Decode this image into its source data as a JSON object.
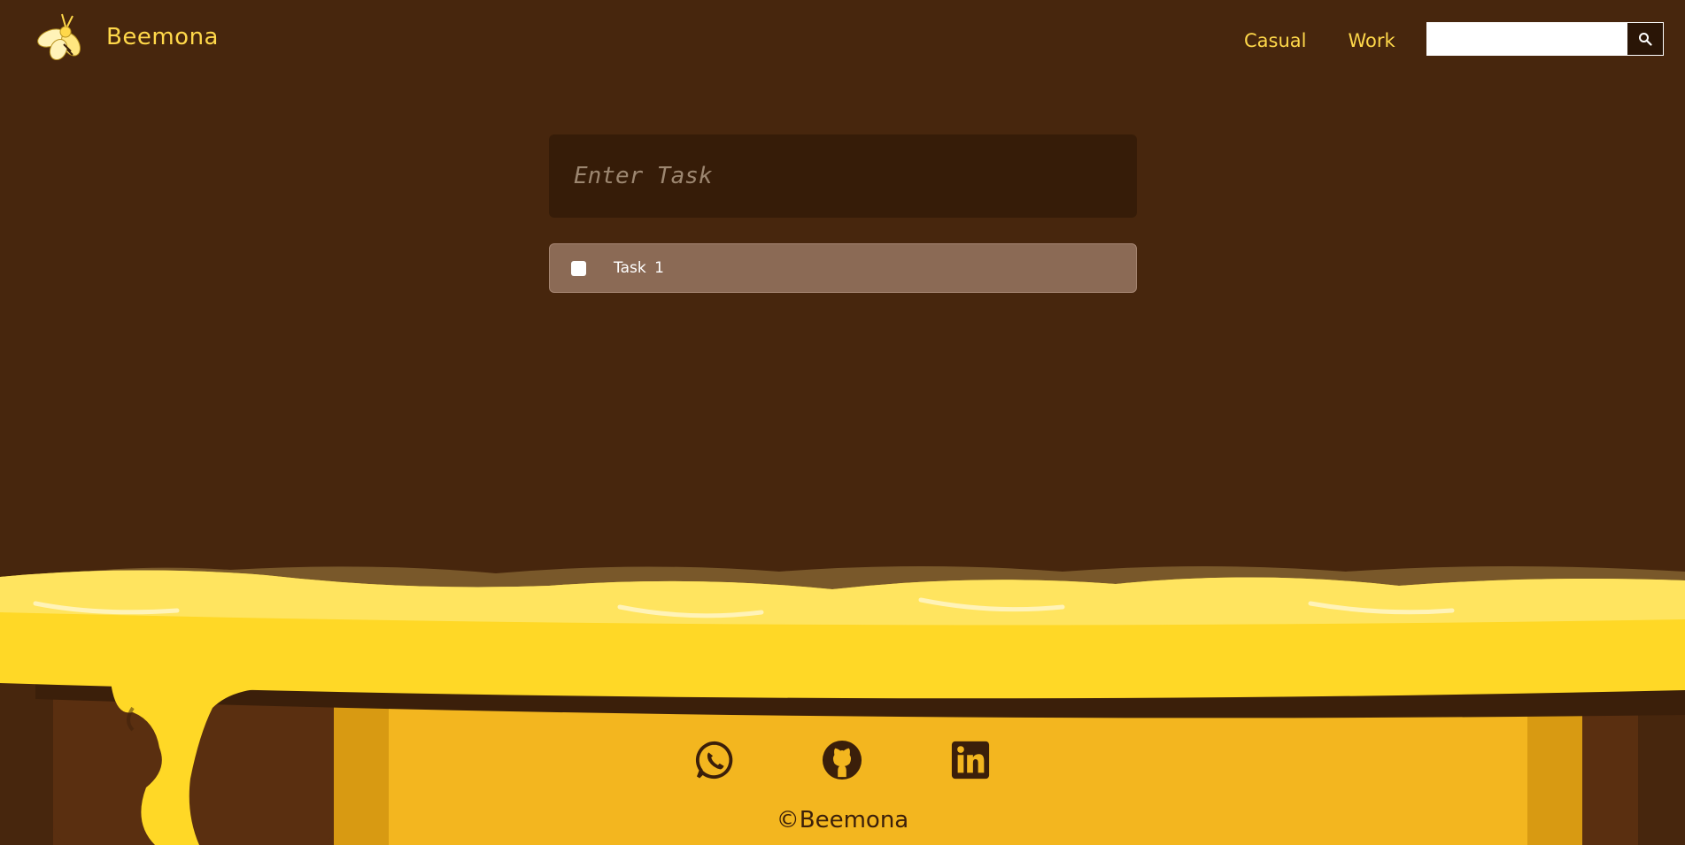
{
  "brand": {
    "name": "Beemona",
    "logo_icon": "bee-icon"
  },
  "nav": {
    "items": [
      {
        "label": "Casual"
      },
      {
        "label": "Work"
      }
    ]
  },
  "search": {
    "value": "",
    "placeholder": "",
    "button_icon": "search-icon"
  },
  "task_input": {
    "placeholder": "Enter Task",
    "value": ""
  },
  "tasks": [
    {
      "label": "Task 1",
      "checked": false
    }
  ],
  "footer": {
    "social": [
      {
        "icon": "whatsapp-icon"
      },
      {
        "icon": "github-icon"
      },
      {
        "icon": "linkedin-icon"
      }
    ],
    "copyright": "©Beemona"
  },
  "colors": {
    "background": "#47260d",
    "accent": "#ffd84a",
    "honey": "#ffd826",
    "task_input_bg": "#361c08",
    "task_item_bg": "#8b6a55",
    "jar_body": "#f3b61f"
  }
}
